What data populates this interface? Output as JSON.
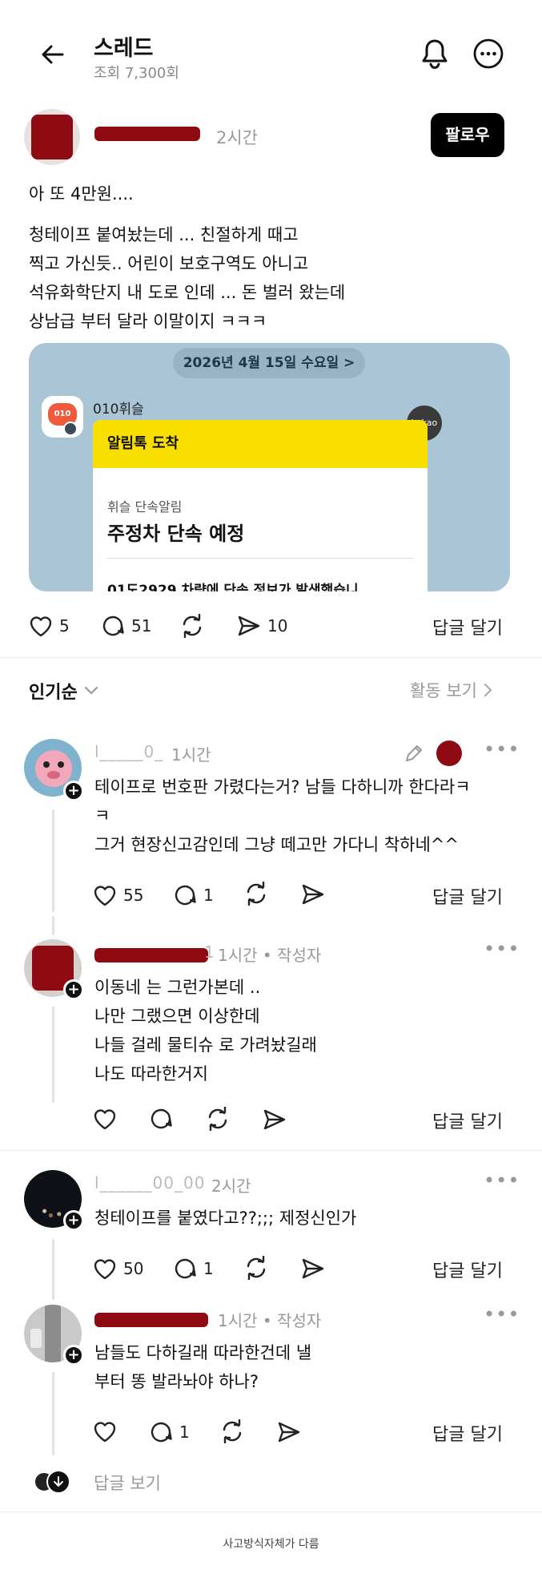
{
  "header": {
    "title": "스레드",
    "views": "조회 7,300회"
  },
  "post": {
    "time": "2시간",
    "follow_label": "팔로우",
    "first_line": "아 또 4만원....",
    "body": "청테이프 붙여놨는데 ... 친절하게 때고\n찍고 가신듯.. 어린이 보호구역도 아니고\n석유화학단지 내 도로 인데 ... 돈 벌러 왔는데\n상남급 부터 달라 이말이지 ㅋㅋㅋ",
    "image": {
      "date_chip": "2026년 4월 15일 수요일 >",
      "sender": "010휘슬",
      "kakao_badge": "kakao",
      "banner": "알림톡 도착",
      "subtitle": "휘슬 단속알림",
      "headline": "주정차 단속 예정",
      "cut_text": "01도2929 차량에 단속 정보가 발생했습니",
      "logo_text": "010"
    },
    "likes": "5",
    "comments": "51",
    "shares": "10",
    "reply_label": "답글 달기"
  },
  "sort": {
    "label": "인기순",
    "activity_label": "활동 보기"
  },
  "comments": [
    {
      "user": "l_____0_",
      "time": "1시간",
      "text": "테이프로 번호판 가렸다는거? 남들 다하니까 한다라ㅋ\nㅋ\n그거 현장신고감인데 그냥 떼고만 가다니 착하네^^",
      "likes": "55",
      "replies": "1",
      "reply_label": "답글 달기"
    },
    {
      "user_suffix": "1",
      "time": "1시간",
      "author_tag": "• 작성자",
      "text": "이동네 는 그런가본데 ..\n나만 그랬으면 이상한데\n나들 걸레 물티슈 로 가려놨길래\n나도 따라한거지",
      "reply_label": "답글 달기"
    },
    {
      "user": "l______00_00",
      "time": "2시간",
      "text": "청테이프를 붙였다고??;;; 제정신인가",
      "likes": "50",
      "replies": "1",
      "reply_label": "답글 달기"
    },
    {
      "time": "1시간",
      "author_tag": "• 작성자",
      "text": "남들도 다하길래 따라한건데 낼\n부터 똥 발라놔야 하나?",
      "replies": "1",
      "reply_label": "답글 달기"
    }
  ],
  "view_replies": "답글 보기",
  "footer_note": "사고방식자체가 다름",
  "colors": {
    "kakao_yellow": "#f9df00",
    "image_bg": "#a9c5d6",
    "redact": "#8e0b14",
    "follow_bg": "#000000"
  }
}
